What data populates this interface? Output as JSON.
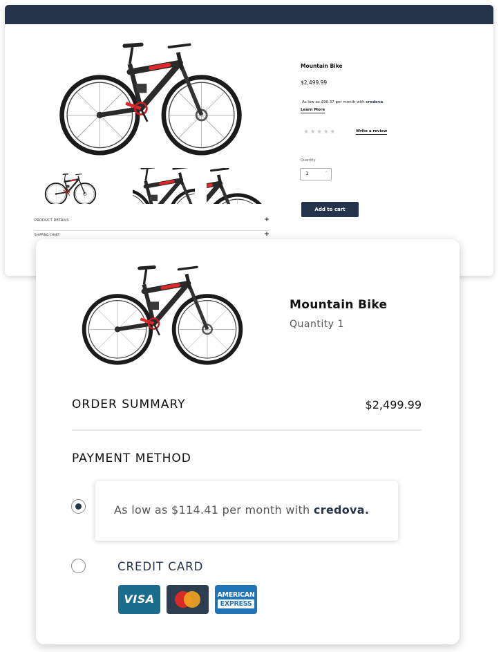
{
  "product_page": {
    "title": "Mountain Bike",
    "price": "$2,499.99",
    "credova_prefix": "As low as $90.37 per month with ",
    "credova_brand": "credova",
    "learn_more": "Learn More",
    "stars": "★★★★★",
    "write_review": "Write a review",
    "quantity_label": "Quantity",
    "quantity_value": "1",
    "add_to_cart": "Add to cart",
    "accordion": [
      "PRODUCT DETAILS",
      "SHIPPING CHART"
    ]
  },
  "checkout": {
    "product_title": "Mountain Bike",
    "quantity": "Quantity 1",
    "order_summary_label": "ORDER SUMMARY",
    "order_total": "$2,499.99",
    "payment_method_label": "PAYMENT METHOD",
    "credova_option_prefix": "As low as $114.41 per month with ",
    "credova_option_brand": "credova",
    "credit_card_label": "CREDIT CARD",
    "card_logos": {
      "visa": "VISA",
      "amex_line1": "AMERICAN",
      "amex_line2": "EXPRESS"
    }
  },
  "colors": {
    "navy": "#25344a",
    "bike_red": "#e0282a"
  }
}
